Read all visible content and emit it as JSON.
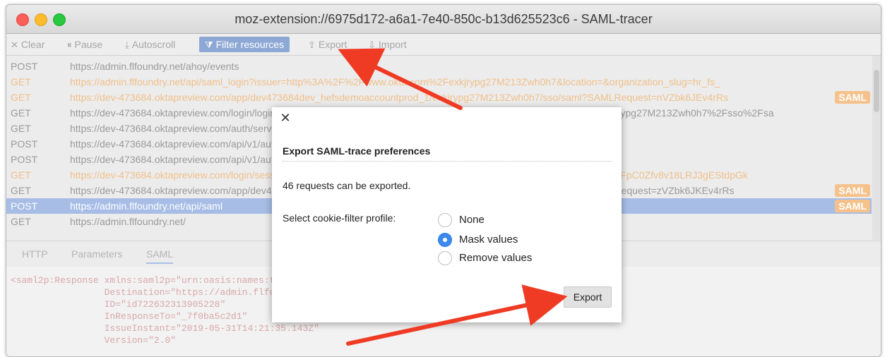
{
  "window": {
    "title": "moz-extension://6975d172-a6a1-7e40-850c-b13d625523c6 - SAML-tracer"
  },
  "toolbar": {
    "clear": {
      "icon": "✕",
      "label": "Clear"
    },
    "pause": {
      "icon": "⏸",
      "label": "Pause"
    },
    "autoscroll": {
      "icon": "⤓",
      "label": "Autoscroll"
    },
    "filter": {
      "icon": "⧩",
      "label": "Filter resources"
    },
    "export": {
      "icon": "⇪",
      "label": "Export"
    },
    "import": {
      "icon": "⇩",
      "label": "Import"
    }
  },
  "requests": [
    {
      "method": "POST",
      "url": "https://admin.flfoundry.net/ahoy/events",
      "style": "normal",
      "badge": ""
    },
    {
      "method": "GET",
      "url": "https://admin.flfoundry.net/api/saml_login?issuer=http%3A%2F%2Fwww.okta.com%2Fexkjrypg27M213Zwh0h7&location=&organization_slug=hr_fs_",
      "style": "orange",
      "badge": ""
    },
    {
      "method": "GET",
      "url": "https://dev-473684.oktapreview.com/app/dev473684dev_hefsdemoaccountprod_1/exkjrypg27M213Zwh0h7/sso/saml?SAMLRequest=nVZbk6JEv4rRs",
      "style": "orange",
      "badge": "SAML"
    },
    {
      "method": "GET",
      "url": "https://dev-473684.oktapreview.com/login/login.htm?fromURI=%2Fapp%2Fdev473684dev_hefsdemoaccountprod_1%2Fexkjrypg27M213Zwh0h7%2Fsso%2Fsa",
      "style": "normal",
      "badge": ""
    },
    {
      "method": "GET",
      "url": "https://dev-473684.oktapreview.com/auth/services/devicefingerprint",
      "style": "normal",
      "badge": ""
    },
    {
      "method": "POST",
      "url": "https://dev-473684.oktapreview.com/api/v1/authn",
      "style": "normal",
      "badge": ""
    },
    {
      "method": "POST",
      "url": "https://dev-473684.oktapreview.com/api/v1/authn/factors",
      "style": "normal",
      "badge": ""
    },
    {
      "method": "GET",
      "url": "https://dev-473684.oktapreview.com/login/sessionCookieRedirect?checkAccountSetupComplete=true&token=20111aSGRf%2FpC0Zfv8v18LRJ3gEStdpGk",
      "style": "orange",
      "badge": ""
    },
    {
      "method": "GET",
      "url": "https://dev-473684.oktapreview.com/app/dev473684dev_hefsdemoaccountprod_1/exkjrypg27M213Zwh0h7/sso/saml?SAMLRequest=zVZbk6JKEv4rRs",
      "style": "normal",
      "badge": "SAML"
    },
    {
      "method": "POST",
      "url": "https://admin.flfoundry.net/api/saml",
      "style": "selected",
      "badge": "SAML"
    },
    {
      "method": "GET",
      "url": "https://admin.flfoundry.net/",
      "style": "normal",
      "badge": ""
    }
  ],
  "tabs": [
    "HTTP",
    "Parameters",
    "SAML"
  ],
  "code_lines": [
    "<saml2p:Response xmlns:saml2p=\"urn:oasis:names:tc:SAML:2.0:protocol\"",
    "                 Destination=\"https://admin.flfoundry.net/api/saml\"",
    "                 ID=\"id722632313905228\"",
    "                 InResponseTo=\"_7f0ba5c2d1\"",
    "                 IssueInstant=\"2019-05-31T14:21:35.143Z\"",
    "                 Version=\"2.0\""
  ],
  "dialog": {
    "close_icon": "✕",
    "title": "Export SAML-trace preferences",
    "count_text": "46 requests can be exported.",
    "filter_label": "Select cookie-filter profile:",
    "options": [
      {
        "label": "None",
        "selected": false
      },
      {
        "label": "Mask values",
        "selected": true
      },
      {
        "label": "Remove values",
        "selected": false
      }
    ],
    "export_label": "Export"
  },
  "colors": {
    "accent": "#3d8aee",
    "annotation_arrow": "#ef3b24",
    "saml_badge": "#f6c28c",
    "selection": "#a7bde6"
  }
}
